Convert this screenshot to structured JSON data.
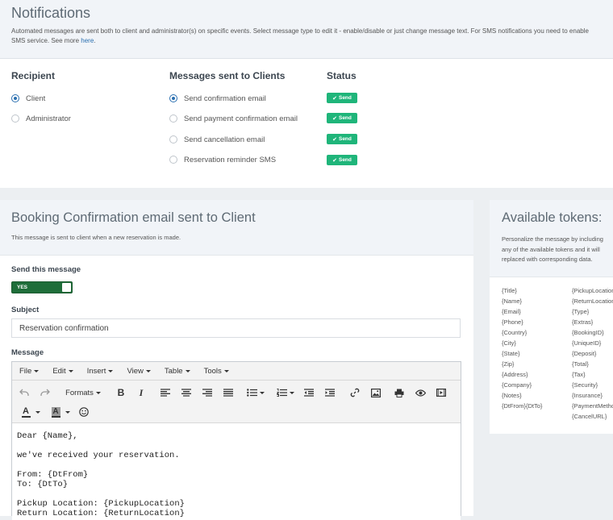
{
  "header": {
    "title": "Notifications",
    "description_line1": "Automated messages are sent both to client and administrator(s) on specific events. Select message type to edit it - enable/disable or just change message text. For SMS notifications you need to enable",
    "description_line2_prefix": "SMS service. See more ",
    "description_link": "here",
    "description_suffix": "."
  },
  "settings": {
    "recipient_heading": "Recipient",
    "recipients": [
      {
        "label": "Client",
        "selected": true
      },
      {
        "label": "Administrator",
        "selected": false
      }
    ],
    "messages_heading": "Messages sent to Clients",
    "messages": [
      {
        "label": "Send confirmation email",
        "selected": true
      },
      {
        "label": "Send payment confirmation email",
        "selected": false
      },
      {
        "label": "Send cancellation email",
        "selected": false
      },
      {
        "label": "Reservation reminder SMS",
        "selected": false
      }
    ],
    "status_heading": "Status",
    "status_label": "Send",
    "status_color": "#1fb57a"
  },
  "booking": {
    "title": "Booking Confirmation email sent to Client",
    "subtitle": "This message is sent to client when a new reservation is made.",
    "send_label": "Send this message",
    "toggle_text": "YES",
    "toggle_color": "#1f6e3a",
    "subject_label": "Subject",
    "subject_value": "Reservation confirmation",
    "message_label": "Message"
  },
  "editor": {
    "menus": [
      "File",
      "Edit",
      "Insert",
      "View",
      "Table",
      "Tools"
    ],
    "formats_label": "Formats",
    "bold_label": "B",
    "italic_label": "I",
    "font_color_label": "A",
    "bg_color_label": "A",
    "toolbar_icons": [
      "undo-icon",
      "redo-icon",
      "bold-icon",
      "italic-icon",
      "align-left-icon",
      "align-center-icon",
      "align-right-icon",
      "align-justify-icon",
      "bullet-list-icon",
      "numbered-list-icon",
      "outdent-icon",
      "indent-icon",
      "link-icon",
      "image-icon",
      "print-icon",
      "preview-icon",
      "media-icon",
      "font-color-icon",
      "background-color-icon",
      "emoticons-icon"
    ],
    "body_lines": [
      "Dear {Name},",
      "we've received your reservation.",
      "From: {DtFrom}",
      "To: {DtTo}",
      "Pickup Location: {PickupLocation}",
      "Return Location: {ReturnLocation}"
    ]
  },
  "tokens": {
    "title": "Available tokens:",
    "description": "Personalize the message by including\nany of the available tokens and it will\nreplaced with corresponding data.",
    "left": [
      "{Title}",
      "{Name}",
      "{Email}",
      "{Phone}",
      "{Country}",
      "{City}",
      "{State}",
      "{Zip}",
      "{Address}",
      "{Company}",
      "{Notes}",
      "{DtFrom}{DtTo}"
    ],
    "right": [
      "{PickupLocation}",
      "{ReturnLocation}",
      "{Type}",
      "{Extras}",
      "{BookingID}",
      "{UniqueID}",
      "{Deposit}",
      "{Total}",
      "{Tax}",
      "{Security}",
      "{Insurance}",
      "{PaymentMethod}",
      "{CancelURL}"
    ]
  }
}
